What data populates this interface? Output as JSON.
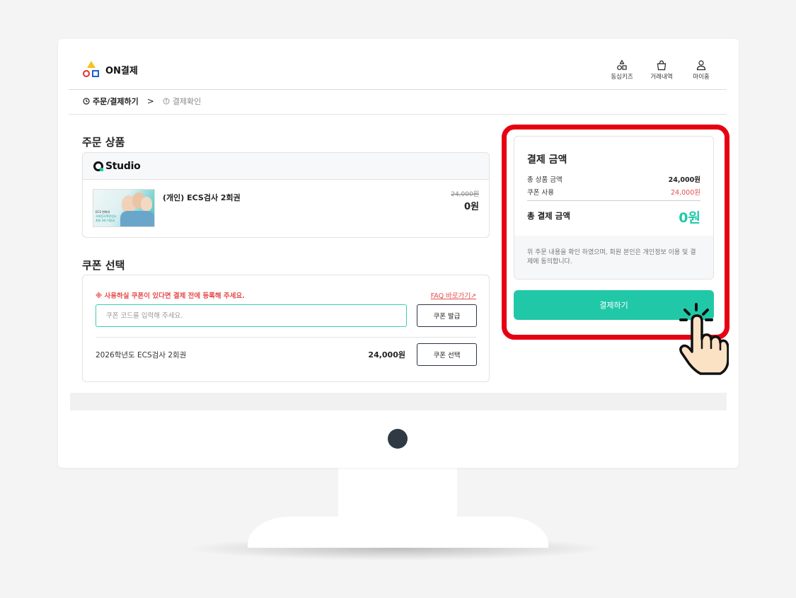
{
  "app": {
    "title": "ON결제"
  },
  "nav": [
    {
      "label": "동심키즈",
      "icon": "kids-shapes-icon"
    },
    {
      "label": "거래내역",
      "icon": "shopping-bag-icon"
    },
    {
      "label": "마이홈",
      "icon": "user-icon"
    }
  ],
  "breadcrumb": {
    "step1": "주문/결제하기",
    "separator": ">",
    "step2": "결제확인"
  },
  "order": {
    "section_title": "주문 상품",
    "brand": "Studio",
    "thumb": {
      "line1": "ECS 변화와",
      "line2": "사회정서역량검사",
      "line3": "최대 3회 이용권"
    },
    "product_name": "(개인) ECS검사 2회권",
    "original_price": "24,000원",
    "final_price": "0원"
  },
  "coupon": {
    "section_title": "쿠폰 선택",
    "notice": "※ 사용하실 쿠폰이 있다면 결제 전에 등록해 주세요.",
    "faq_link": "FAQ 바로가기↗",
    "input_placeholder": "쿠폰 코드를 입력해 주세요.",
    "issue_button": "쿠폰 발급",
    "item_name": "2026학년도 ECS검사 2회권",
    "item_price": "24,000원",
    "select_button": "쿠폰 선택"
  },
  "summary": {
    "title": "결제 금액",
    "subtotal_label": "총 상품 금액",
    "subtotal_value": "24,000원",
    "coupon_label": "쿠폰 사용",
    "coupon_value": "24,000원",
    "total_label": "총 결제 금액",
    "total_value": "0원",
    "consent": "위 주문 내용을 확인 하였으며, 회원 본인은 개인정보 이용 및 결제에 동의합니다.",
    "pay_button": "결제하기"
  },
  "colors": {
    "accent": "#21c8a8",
    "highlight": "#e60012",
    "discount": "#e84b4b",
    "dark_button_border": "#2b3345"
  }
}
